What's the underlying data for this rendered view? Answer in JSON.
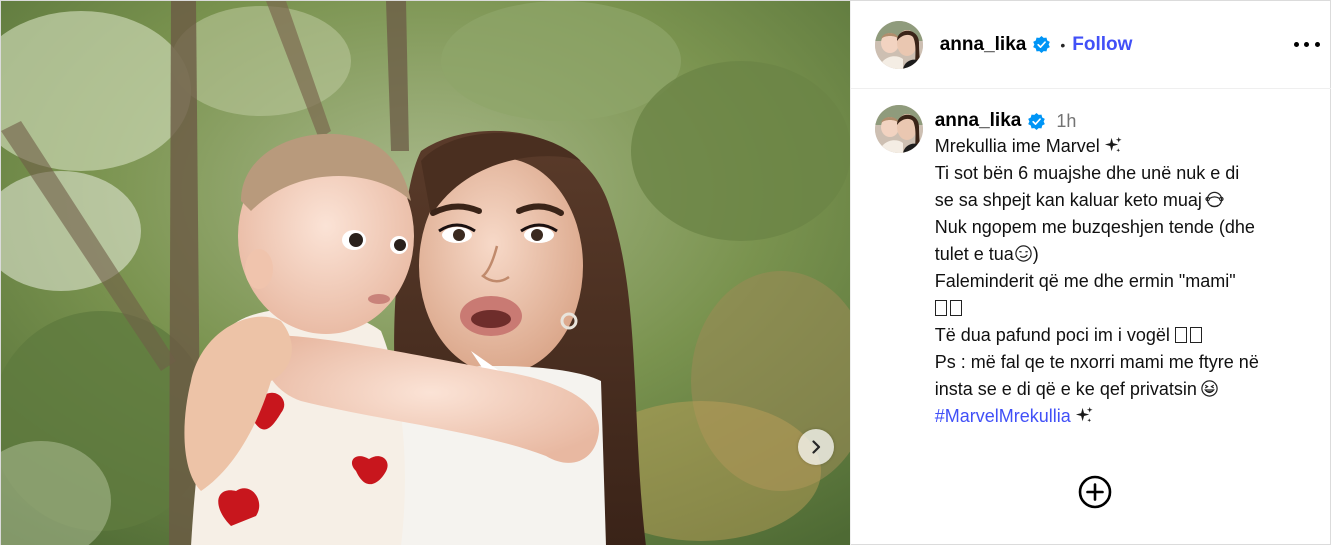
{
  "header": {
    "username": "anna_lika",
    "dot": "•",
    "follow_label": "Follow",
    "avatar_icon": "avatar-photo",
    "verified_icon": "verified-badge-icon",
    "more_icon": "more-options-icon"
  },
  "caption": {
    "username": "anna_lika",
    "time": "1h",
    "lines": {
      "l1": "Mrekullia ime Marvel",
      "l2": "Ti sot bën 6 muajshe dhe unë nuk e di",
      "l3": "se sa shpejt kan kaluar keto muaj",
      "l4": "Nuk ngopem me buzqeshjen tende (dhe",
      "l5": "tulet e tua",
      "l5_end": ")",
      "l6": "Faleminderit që me dhe ermin \"mami\"",
      "l8": "Të dua pafund poci im i vogël",
      "l9": "Ps : më fal qe te nxorri mami me ftyre në",
      "l10": "insta se e di që e ke qef privatsin",
      "hashtag": "#MarvelMrekullia"
    }
  },
  "media": {
    "next_icon": "chevron-right-icon"
  },
  "actions": {
    "add_comment_icon": "add-circle-icon"
  },
  "colors": {
    "link_blue": "#4150f7",
    "verified_blue": "#0095f6",
    "muted": "#737373"
  }
}
